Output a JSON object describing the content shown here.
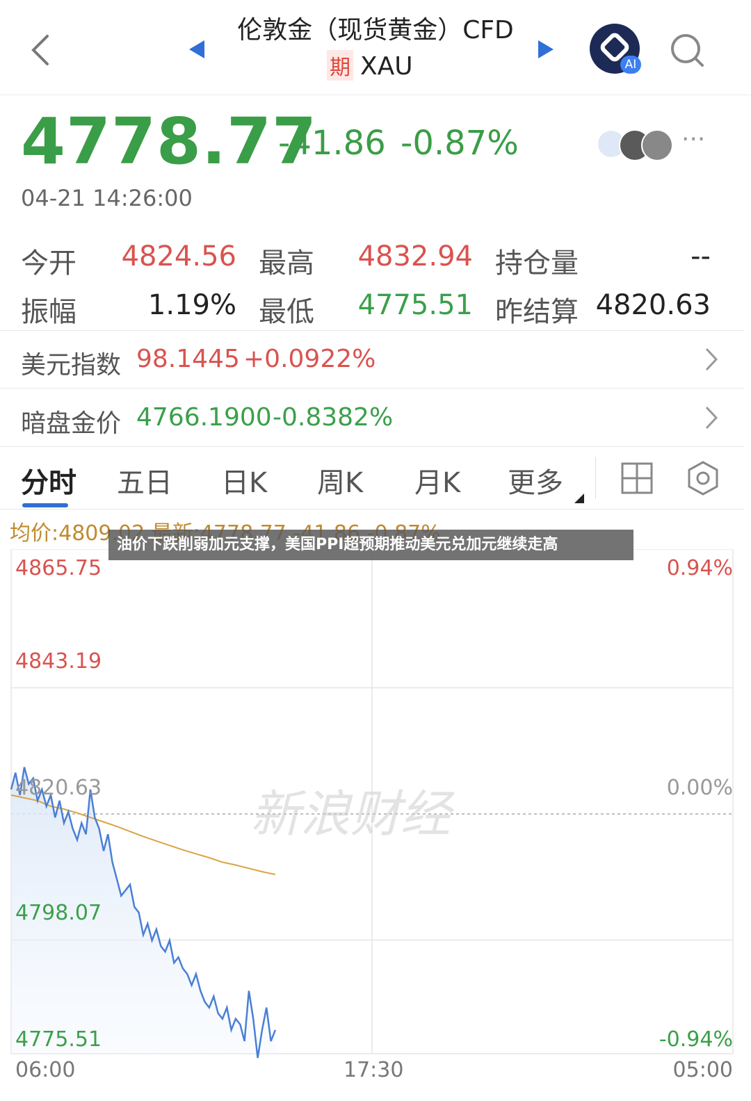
{
  "header": {
    "back_icon": "chevron-left-icon",
    "title": "伦敦金（现货黄金）CFD",
    "tag": "期",
    "symbol": "XAU",
    "prev_icon": "triangle-left-icon",
    "next_icon": "triangle-right-icon",
    "ai_badge": "AI",
    "search_icon": "search-icon"
  },
  "quote": {
    "price": "4778.77",
    "change": "-41.86",
    "change_pct": "-0.87%",
    "timestamp": "04-21 14:26:00",
    "more_label": "···"
  },
  "stats": {
    "open_label": "今开",
    "open_value": "4824.56",
    "high_label": "最高",
    "high_value": "4832.94",
    "oi_label": "持仓量",
    "oi_value": "--",
    "amp_label": "振幅",
    "amp_value": "1.19%",
    "low_label": "最低",
    "low_value": "4775.51",
    "settle_label": "昨结算",
    "settle_value": "4820.63"
  },
  "usd_index": {
    "label": "美元指数",
    "value": "98.1445",
    "change": "+0.0922%"
  },
  "dark_price": {
    "label": "暗盘金价",
    "value": "4766.1900",
    "change": "-0.8382%"
  },
  "tabs": [
    "分时",
    "五日",
    "日K",
    "周K",
    "月K",
    "更多"
  ],
  "chart_legend": "均价:4809.02  最新:4778.77  -41.86  -0.87%",
  "banner": "油价下跌削弱加元支撑，美国PPI超预期推动美元兑加元继续走高",
  "watermark": "新浪财经",
  "colors": {
    "up": "#d9534f",
    "down": "#3aa04a",
    "line": "#4a7fd4",
    "avg": "#d9a441"
  },
  "chart_data": {
    "type": "line",
    "x_ticks": [
      "06:00",
      "17:30",
      "05:00"
    ],
    "y_ticks_left": [
      "4865.75",
      "4843.19",
      "4820.63",
      "4798.07",
      "4775.51"
    ],
    "y_ticks_right": [
      "0.94%",
      "0.00%",
      "-0.94%"
    ],
    "ylim": [
      4775.51,
      4865.75
    ],
    "reference": 4820.63,
    "series": [
      {
        "values": [
          4825,
          4828,
          4824,
          4829,
          4826,
          4827,
          4823,
          4825,
          4822,
          4824,
          4820,
          4823,
          4819,
          4821,
          4818,
          4816,
          4819,
          4817,
          4825,
          4820,
          4818,
          4814,
          4817,
          4812,
          4809,
          4806,
          4807,
          4808,
          4804,
          4803,
          4799,
          4801,
          4798,
          4800,
          4797,
          4796,
          4798,
          4794,
          4795,
          4793,
          4792,
          4790,
          4792,
          4789,
          4787,
          4786,
          4788,
          4785,
          4784,
          4786,
          4782,
          4784,
          4783,
          4780,
          4789,
          4784,
          4777,
          4782,
          4786,
          4780,
          4782
        ]
      },
      {
        "values": [
          4824,
          4823.5,
          4823,
          4822,
          4821.5,
          4820.8,
          4820,
          4819.2,
          4818.4,
          4817.5,
          4816.6,
          4815.8,
          4815,
          4814.2,
          4813.5,
          4812.8,
          4812,
          4811.5,
          4810.9,
          4810.3,
          4809.8
        ]
      }
    ]
  }
}
